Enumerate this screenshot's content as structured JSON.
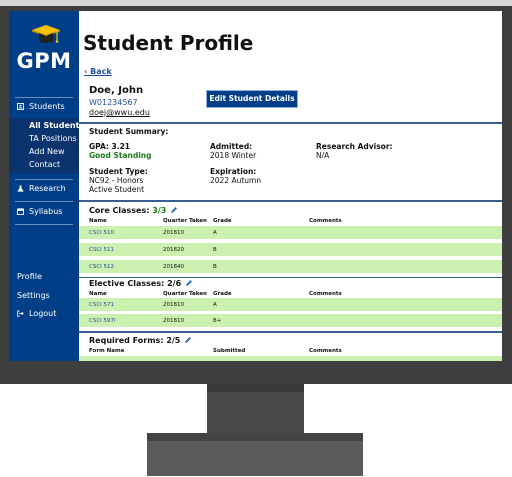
{
  "app": {
    "logo_text": "GPM"
  },
  "sidebar": {
    "students_label": "Students",
    "students_sub": [
      "All Students",
      "TA Positions",
      "Add New",
      "Contact"
    ],
    "research_label": "Research",
    "syllabus_label": "Syllabus",
    "profile_label": "Profile",
    "settings_label": "Settings",
    "logout_label": "Logout"
  },
  "page": {
    "title": "Student Profile",
    "back_label": "Back",
    "student_name": "Doe, John",
    "student_id": "W01234567",
    "student_email": "doej@wwu.edu",
    "edit_button_label": "Edit Student Details"
  },
  "summary": {
    "heading": "Student Summary:",
    "gpa_label": "GPA: 3.21",
    "standing": "Good Standing",
    "admitted_label": "Admitted:",
    "admitted_value": "2018 Winter",
    "advisor_label": "Research Advisor:",
    "advisor_value": "N/A",
    "type_label": "Student Type:",
    "type_value_1": "NC92 - Honors",
    "type_value_2": "Active Student",
    "expiration_label": "Expiration:",
    "expiration_value": "2022 Autumn"
  },
  "core": {
    "title": "Core Classes:",
    "count": "3/3",
    "headers": [
      "Name",
      "Quarter Taken",
      "Grade",
      "Comments"
    ],
    "rows": [
      [
        "CSCI 510",
        "201810",
        "A",
        ""
      ],
      [
        "CSCI 511",
        "201820",
        "B",
        ""
      ],
      [
        "CSCI 512",
        "201840",
        "B",
        ""
      ]
    ]
  },
  "elective": {
    "title": "Elective Classes:",
    "count": "2/6",
    "headers": [
      "Name",
      "Quarter Taken",
      "Grade",
      "Comments"
    ],
    "rows": [
      [
        "CSCI 571",
        "201810",
        "A",
        ""
      ],
      [
        "CSCI 597I",
        "201810",
        "B+",
        ""
      ]
    ]
  },
  "forms": {
    "title": "Required Forms:",
    "count": "2/5",
    "headers": [
      "Form Name",
      "Submitted",
      "Comments"
    ]
  },
  "colors": {
    "brand": "#003f87",
    "row_green": "#ccf0b0",
    "standing_green": "#1d7a1d",
    "link_blue": "#1f4f9c"
  }
}
